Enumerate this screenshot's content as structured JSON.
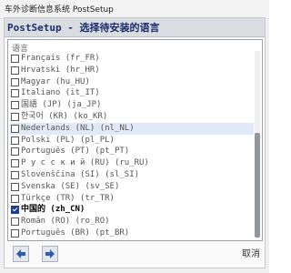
{
  "window": {
    "title": "车外诊断信息系统 PostSetup"
  },
  "header": {
    "title": "PostSetup - 选择待安装的语言"
  },
  "language_list": {
    "label": "语言",
    "items": [
      {
        "label": "Français  (fr_FR)",
        "checked": false
      },
      {
        "label": "Hrvatski  (hr_HR)",
        "checked": false
      },
      {
        "label": "Magyar  (hu_HU)",
        "checked": false
      },
      {
        "label": "Italiano  (it_IT)",
        "checked": false
      },
      {
        "label": "国語 (JP)  (ja_JP)",
        "checked": false
      },
      {
        "label": "한국어 (KR)  (ko_KR)",
        "checked": false
      },
      {
        "label": "Nederlands (NL)  (nl_NL)",
        "checked": false,
        "highlighted": true
      },
      {
        "label": "Polski (PL)  (pl_PL)",
        "checked": false
      },
      {
        "label": "Português (PT)  (pt_PT)",
        "checked": false
      },
      {
        "label": "Р у с с к и й  (RU)  (ru_RU)",
        "checked": false
      },
      {
        "label": "Slovenščina (SI)  (sl_SI)",
        "checked": false
      },
      {
        "label": "Svenska (SE)  (sv_SE)",
        "checked": false
      },
      {
        "label": "Türkçe (TR)  (tr_TR)",
        "checked": false
      },
      {
        "label": "中国的   (zh_CN)",
        "checked": true
      },
      {
        "label": "Român (RO)  (ro_RO)",
        "checked": false
      },
      {
        "label": "Português (BR)  (pt_BR)",
        "checked": false
      }
    ]
  },
  "footer": {
    "cancel_label": "取消"
  },
  "colors": {
    "header_bg": "#d9dde2",
    "header_text": "#1a2c6b",
    "check_color": "#1e3c8c",
    "nav_arrow": "#2a5fb0"
  },
  "icons": {
    "back": "arrow-left-icon",
    "forward": "arrow-right-icon"
  }
}
